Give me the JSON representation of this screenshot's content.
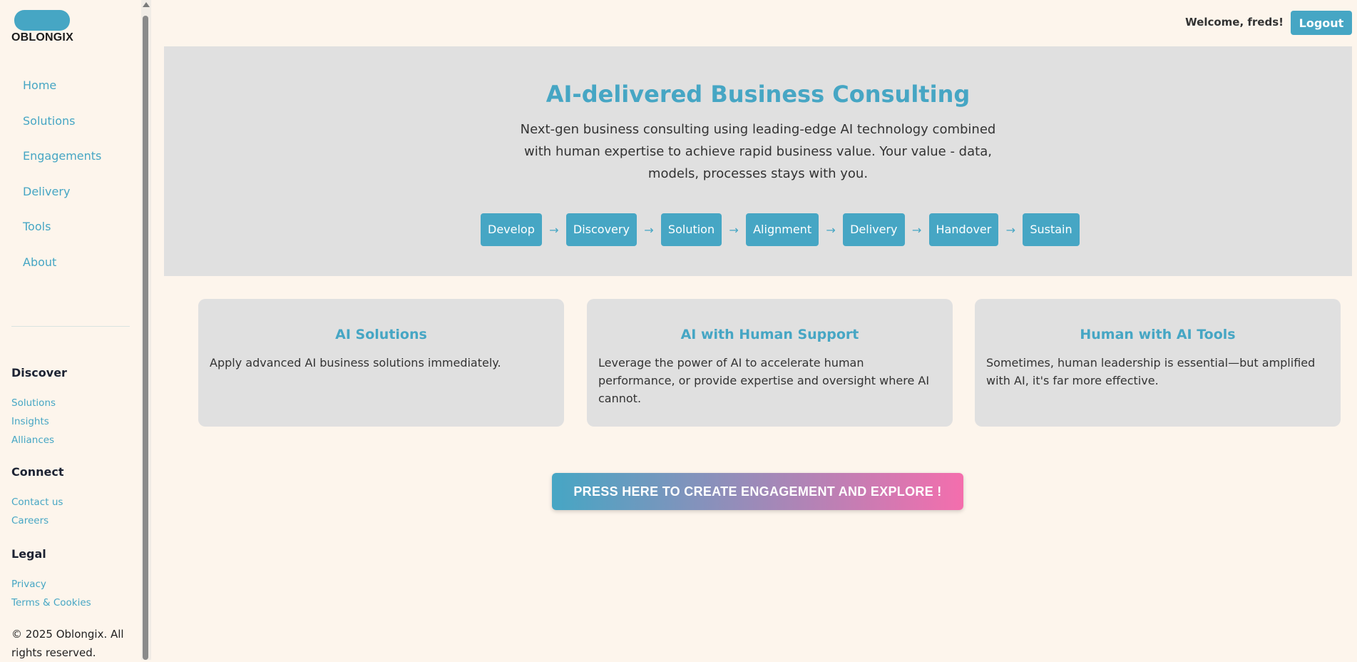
{
  "brand": {
    "name": "OBLONGIX",
    "accent": "#46a6c4"
  },
  "sidebar": {
    "nav": [
      {
        "label": "Home"
      },
      {
        "label": "Solutions"
      },
      {
        "label": "Engagements"
      },
      {
        "label": "Delivery"
      },
      {
        "label": "Tools"
      },
      {
        "label": "About"
      }
    ],
    "footer": {
      "discover": {
        "heading": "Discover",
        "links": [
          "Solutions",
          "Insights",
          "Alliances"
        ]
      },
      "connect": {
        "heading": "Connect",
        "links": [
          "Contact us",
          "Careers"
        ]
      },
      "legal": {
        "heading": "Legal",
        "links": [
          "Privacy",
          "Terms & Cookies"
        ]
      },
      "copyright": "© 2025 Oblongix. All rights reserved."
    }
  },
  "header": {
    "welcome": "Welcome, freds!",
    "logout_label": "Logout"
  },
  "hero": {
    "title": "AI-delivered Business Consulting",
    "subtitle": "Next-gen business consulting using leading-edge AI technology combined with human expertise to achieve rapid business value. Your value - data, models, processes stays with you.",
    "steps": [
      "Develop",
      "Discovery",
      "Solution",
      "Alignment",
      "Delivery",
      "Handover",
      "Sustain"
    ],
    "arrow": "→"
  },
  "cards": [
    {
      "title": "AI Solutions",
      "text": "Apply advanced AI business solutions immediately."
    },
    {
      "title": "AI with Human Support",
      "text": "Leverage the power of AI to accelerate human performance, or provide expertise and oversight where AI cannot."
    },
    {
      "title": "Human with AI Tools",
      "text": "Sometimes, human leadership is essential—but amplified with AI, it's far more effective."
    }
  ],
  "cta": {
    "label": "PRESS HERE TO CREATE ENGAGEMENT AND EXPLORE !"
  }
}
